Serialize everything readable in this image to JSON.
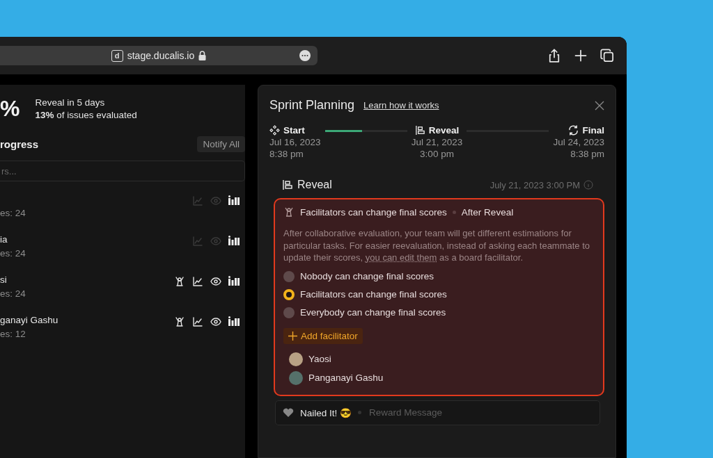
{
  "browser": {
    "url": "stage.ducalis.io",
    "favicon": "d"
  },
  "summary": {
    "big_value": "%",
    "line_1": "Reveal in 5 days",
    "line_2": "**13%** of issues evaluated"
  },
  "progress": {
    "heading": "rogress",
    "notify_button": "Notify All",
    "search": {
      "placeholder": "rs..."
    },
    "members": [
      {
        "count": "es: 24",
        "facilitator": false,
        "active": false
      },
      {
        "name": "ia",
        "count": "es: 24",
        "facilitator": false,
        "active": false
      },
      {
        "name": "si",
        "count": "es: 24",
        "facilitator": true,
        "active": true
      },
      {
        "name": "ganayi Gashu",
        "count": "es: 12",
        "facilitator": true,
        "active": true
      }
    ]
  },
  "modal": {
    "title": "Sprint Planning",
    "link": "Learn how it works",
    "stages": [
      {
        "kind": "start",
        "label": "Start",
        "date": "Jul 16, 2023",
        "time": "8:38 pm",
        "level": 0.45
      },
      {
        "kind": "reveal",
        "label": "Reveal",
        "date": "Jul 21, 2023",
        "time": "3:00 pm"
      },
      {
        "kind": "final",
        "label": "Final",
        "date": "Jul 24, 2023",
        "time": "8:38 pm"
      }
    ],
    "section": {
      "title": "Reveal",
      "datetime": "July 21, 2023 3:00 PM"
    },
    "card": {
      "title": "Facilitators can change final scores",
      "subtitle": "After Reveal",
      "description_before": "After collaborative evaluation, your team will get different estimations for particular tasks. For easier reevaluation, instead of asking each teammate to update their scores,",
      "description_link": "you can edit them",
      "description_after": "as a board facilitator.",
      "options": [
        {
          "label": "Nobody can change final scores",
          "selected": false
        },
        {
          "label": "Facilitators can change final scores",
          "selected": true
        },
        {
          "label": "Everybody can change final scores",
          "selected": false
        }
      ],
      "add_button": "Add facilitator",
      "facilitators": [
        {
          "name": "Yaosi"
        },
        {
          "name": "Panganayi Gashu"
        }
      ]
    },
    "reward": {
      "title": "Nailed It! 😎",
      "placeholder": "Reward Message"
    }
  }
}
